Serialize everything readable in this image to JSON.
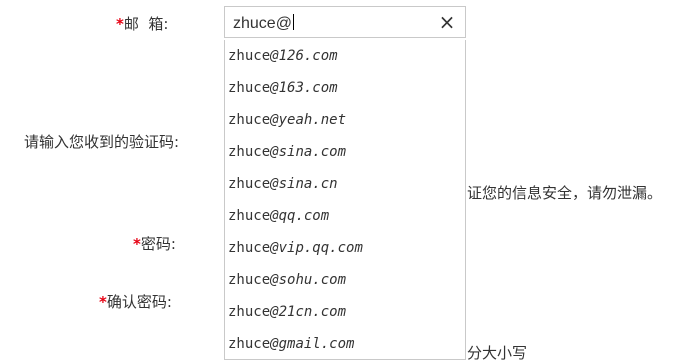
{
  "form": {
    "email_label": "邮  箱:",
    "code_label": "请输入您收到的验证码:",
    "password_label": "密码:",
    "confirm_label": "确认密码:",
    "required_mark": "*",
    "hint_security": "证您的信息安全，请勿泄漏。",
    "hint_case": "分大小写",
    "email_value": "zhuce@",
    "clear_icon": "×"
  },
  "suggestions": [
    {
      "user": "zhuce",
      "domain": "@126.com"
    },
    {
      "user": "zhuce",
      "domain": "@163.com"
    },
    {
      "user": "zhuce",
      "domain": "@yeah.net"
    },
    {
      "user": "zhuce",
      "domain": "@sina.com"
    },
    {
      "user": "zhuce",
      "domain": "@sina.cn"
    },
    {
      "user": "zhuce",
      "domain": "@qq.com"
    },
    {
      "user": "zhuce",
      "domain": "@vip.qq.com"
    },
    {
      "user": "zhuce",
      "domain": "@sohu.com"
    },
    {
      "user": "zhuce",
      "domain": "@21cn.com"
    },
    {
      "user": "zhuce",
      "domain": "@gmail.com"
    }
  ],
  "colors": {
    "required": "#e60012",
    "border": "#c9c9c9",
    "text": "#333333"
  }
}
